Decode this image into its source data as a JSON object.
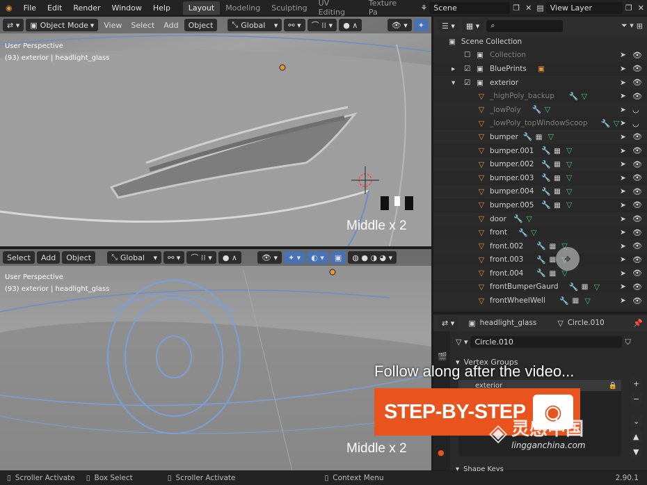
{
  "topbar": {
    "menus": [
      "File",
      "Edit",
      "Render",
      "Window",
      "Help"
    ],
    "workspaces": [
      "Layout",
      "Modeling",
      "Sculpting",
      "UV Editing",
      "Texture Pa"
    ],
    "scene": "Scene",
    "view_layer": "View Layer"
  },
  "viewport_top": {
    "mode": "Object Mode",
    "menus": [
      "View",
      "Select",
      "Add",
      "Object"
    ],
    "orientation": "Global",
    "perspective": "User Perspective",
    "info": "(93) exterior | headlight_glass",
    "hint": "Middle x 2"
  },
  "viewport_bottom": {
    "menus": [
      "Select",
      "Add",
      "Object"
    ],
    "orientation": "Global",
    "perspective": "User Perspective",
    "info": "(93) exterior | headlight_glass",
    "hint": "Middle x 2"
  },
  "overlay": {
    "follow": "Follow along after the video...",
    "banner": "STEP-BY-STEP",
    "watermark_cn": "灵感中国",
    "watermark_url": "lingganchina.com"
  },
  "outliner": {
    "root": "Scene Collection",
    "rows": [
      {
        "label": "Collection"
      },
      {
        "label": "BluePrints"
      },
      {
        "label": "exterior"
      },
      {
        "label": "_highPoly_backup"
      },
      {
        "label": "_lowPoly"
      },
      {
        "label": "_lowPoly_topWindowScoop"
      },
      {
        "label": "bumper"
      },
      {
        "label": "bumper.001"
      },
      {
        "label": "bumper.002"
      },
      {
        "label": "bumper.003"
      },
      {
        "label": "bumper.004"
      },
      {
        "label": "bumper.005"
      },
      {
        "label": "door"
      },
      {
        "label": "front"
      },
      {
        "label": "front.002"
      },
      {
        "label": "front.003"
      },
      {
        "label": "front.004"
      },
      {
        "label": "frontBumperGaurd"
      },
      {
        "label": "frontWheelWell"
      }
    ]
  },
  "properties": {
    "object": "headlight_glass",
    "mesh": "Circle.010",
    "mesh_field": "Circle.010",
    "vertex_groups_label": "Vertex Groups",
    "vertex_group": "exterior",
    "shape_keys_label": "Shape Keys"
  },
  "status": {
    "items": [
      "Scroller Activate",
      "Box Select",
      "Scroller Activate",
      "Context Menu"
    ],
    "version": "2.90.1"
  },
  "colors": {
    "accent": "#4772b3",
    "orange": "#e8943a",
    "banner": "#e8531e"
  }
}
